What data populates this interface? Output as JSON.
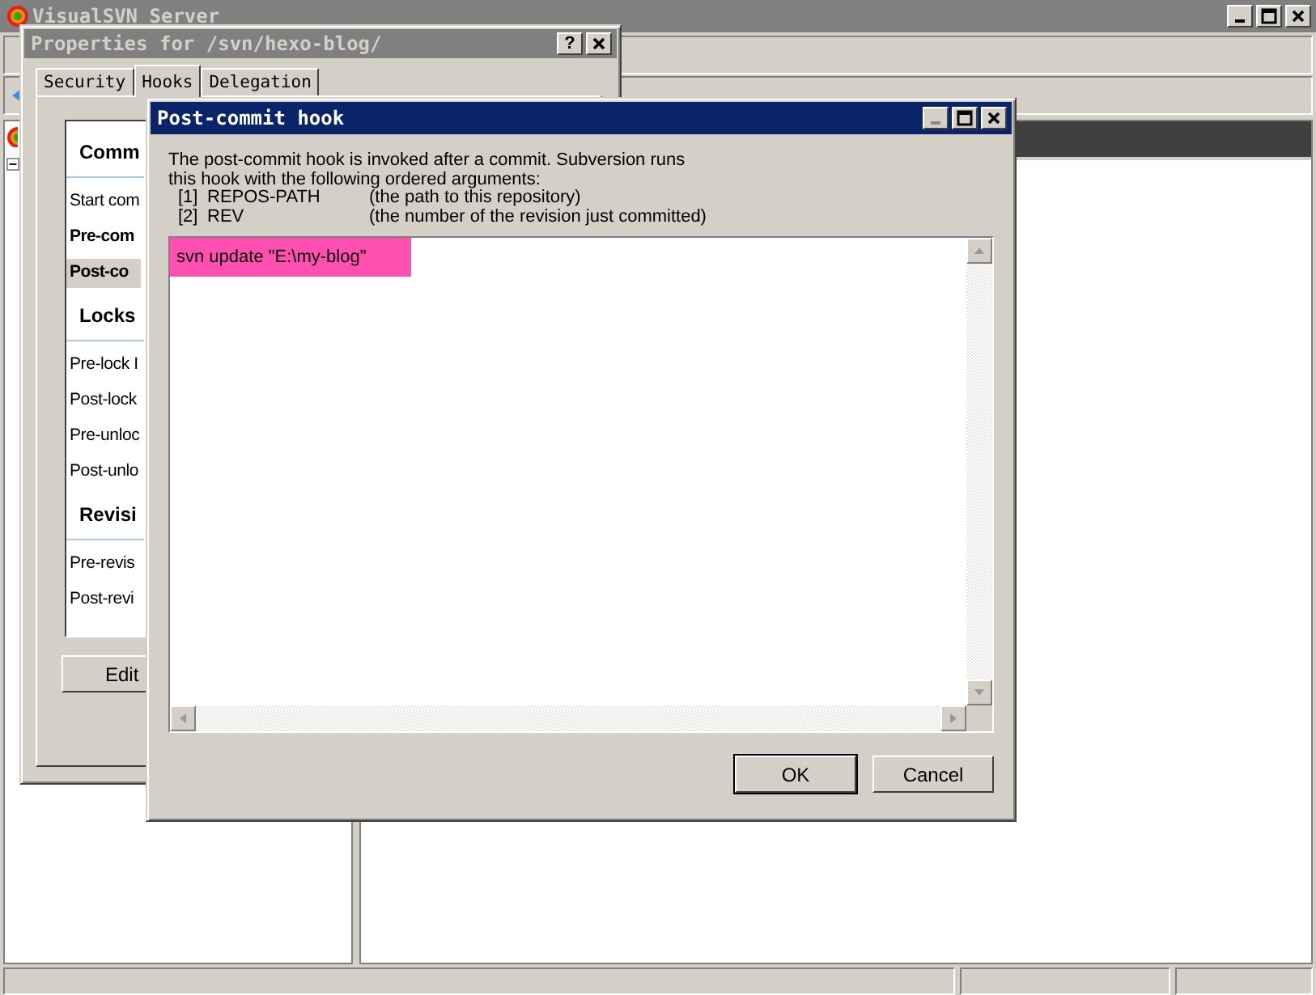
{
  "main_window": {
    "title": "VisualSVN Server"
  },
  "properties_window": {
    "title": "Properties for /svn/hexo-blog/",
    "help_button": "?",
    "tabs": [
      {
        "label": "Security",
        "selected": false
      },
      {
        "label": "Hooks",
        "selected": true
      },
      {
        "label": "Delegation",
        "selected": false
      }
    ],
    "hook_groups": [
      {
        "heading": "Comm",
        "items": [
          {
            "label": "Start com",
            "configured": false,
            "selected": false
          },
          {
            "label": "Pre-com",
            "configured": true,
            "selected": false
          },
          {
            "label": "Post-co",
            "configured": true,
            "selected": true
          }
        ]
      },
      {
        "heading": "Locks",
        "items": [
          {
            "label": "Pre-lock I",
            "configured": false,
            "selected": false
          },
          {
            "label": "Post-lock",
            "configured": false,
            "selected": false
          },
          {
            "label": "Pre-unloc",
            "configured": false,
            "selected": false
          },
          {
            "label": "Post-unlo",
            "configured": false,
            "selected": false
          }
        ]
      },
      {
        "heading": "Revisi",
        "items": [
          {
            "label": "Pre-revis",
            "configured": false,
            "selected": false
          },
          {
            "label": "Post-revi",
            "configured": false,
            "selected": false
          }
        ]
      }
    ],
    "edit_button": "Edit"
  },
  "dialog": {
    "title": "Post-commit hook",
    "description": [
      "The post-commit hook is invoked after a commit. Subversion runs",
      "this hook with the following ordered arguments:"
    ],
    "arguments": [
      {
        "index": "[1]",
        "name": "REPOS-PATH",
        "note": "(the path to this repository)"
      },
      {
        "index": "[2]",
        "name": "REV",
        "note": "(the number of the revision just committed)"
      }
    ],
    "script": {
      "value": "svn update \"E:\\my-blog\"",
      "highlighted": true
    },
    "buttons": [
      {
        "label": "OK",
        "default": true
      },
      {
        "label": "Cancel",
        "default": false
      }
    ]
  }
}
